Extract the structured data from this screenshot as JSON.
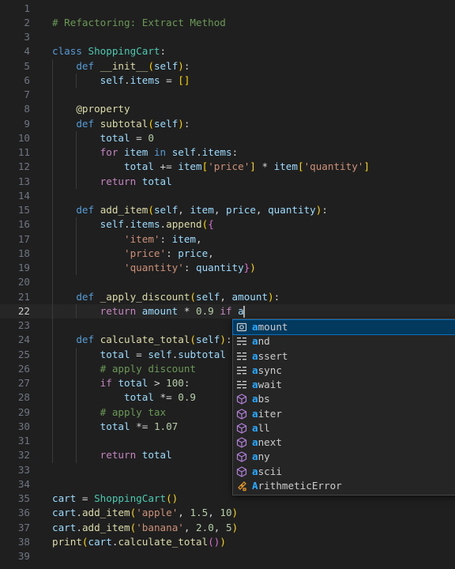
{
  "editor": {
    "active_line": 22,
    "lines": [
      {
        "n": "1",
        "t": []
      },
      {
        "n": "2",
        "t": [
          [
            "cm",
            "# Refactoring: Extract Method"
          ]
        ]
      },
      {
        "n": "3",
        "t": []
      },
      {
        "n": "4",
        "t": [
          [
            "k",
            "class"
          ],
          [
            "t",
            " "
          ],
          [
            "c",
            "ShoppingCart"
          ],
          [
            "t",
            ":"
          ]
        ]
      },
      {
        "n": "5",
        "t": [
          [
            "t",
            "    "
          ],
          [
            "k",
            "def"
          ],
          [
            "t",
            " "
          ],
          [
            "f",
            "__init__"
          ],
          [
            "b1",
            "("
          ],
          [
            "v",
            "self"
          ],
          [
            "b1",
            ")"
          ],
          [
            "t",
            ":"
          ]
        ]
      },
      {
        "n": "6",
        "t": [
          [
            "t",
            "        "
          ],
          [
            "v",
            "self"
          ],
          [
            "t",
            "."
          ],
          [
            "v",
            "items"
          ],
          [
            "t",
            " = "
          ],
          [
            "b1",
            "[]"
          ]
        ]
      },
      {
        "n": "7",
        "t": []
      },
      {
        "n": "8",
        "t": [
          [
            "t",
            "    "
          ],
          [
            "d",
            "@property"
          ]
        ]
      },
      {
        "n": "9",
        "t": [
          [
            "t",
            "    "
          ],
          [
            "k",
            "def"
          ],
          [
            "t",
            " "
          ],
          [
            "f",
            "subtotal"
          ],
          [
            "b1",
            "("
          ],
          [
            "v",
            "self"
          ],
          [
            "b1",
            ")"
          ],
          [
            "t",
            ":"
          ]
        ]
      },
      {
        "n": "10",
        "t": [
          [
            "t",
            "        "
          ],
          [
            "v",
            "total"
          ],
          [
            "t",
            " = "
          ],
          [
            "n",
            "0"
          ]
        ]
      },
      {
        "n": "11",
        "t": [
          [
            "t",
            "        "
          ],
          [
            "kc",
            "for"
          ],
          [
            "t",
            " "
          ],
          [
            "v",
            "item"
          ],
          [
            "t",
            " "
          ],
          [
            "k",
            "in"
          ],
          [
            "t",
            " "
          ],
          [
            "v",
            "self"
          ],
          [
            "t",
            "."
          ],
          [
            "v",
            "items"
          ],
          [
            "t",
            ":"
          ]
        ]
      },
      {
        "n": "12",
        "t": [
          [
            "t",
            "            "
          ],
          [
            "v",
            "total"
          ],
          [
            "t",
            " += "
          ],
          [
            "v",
            "item"
          ],
          [
            "b1",
            "["
          ],
          [
            "s",
            "'price'"
          ],
          [
            "b1",
            "]"
          ],
          [
            "t",
            " * "
          ],
          [
            "v",
            "item"
          ],
          [
            "b1",
            "["
          ],
          [
            "s",
            "'quantity'"
          ],
          [
            "b1",
            "]"
          ]
        ]
      },
      {
        "n": "13",
        "t": [
          [
            "t",
            "        "
          ],
          [
            "kc",
            "return"
          ],
          [
            "t",
            " "
          ],
          [
            "v",
            "total"
          ]
        ]
      },
      {
        "n": "14",
        "t": []
      },
      {
        "n": "15",
        "t": [
          [
            "t",
            "    "
          ],
          [
            "k",
            "def"
          ],
          [
            "t",
            " "
          ],
          [
            "f",
            "add_item"
          ],
          [
            "b1",
            "("
          ],
          [
            "v",
            "self"
          ],
          [
            "t",
            ", "
          ],
          [
            "v",
            "item"
          ],
          [
            "t",
            ", "
          ],
          [
            "v",
            "price"
          ],
          [
            "t",
            ", "
          ],
          [
            "v",
            "quantity"
          ],
          [
            "b1",
            ")"
          ],
          [
            "t",
            ":"
          ]
        ]
      },
      {
        "n": "16",
        "t": [
          [
            "t",
            "        "
          ],
          [
            "v",
            "self"
          ],
          [
            "t",
            "."
          ],
          [
            "v",
            "items"
          ],
          [
            "t",
            "."
          ],
          [
            "f",
            "append"
          ],
          [
            "b1",
            "("
          ],
          [
            "b2",
            "{"
          ]
        ]
      },
      {
        "n": "17",
        "t": [
          [
            "t",
            "            "
          ],
          [
            "s",
            "'item'"
          ],
          [
            "t",
            ": "
          ],
          [
            "v",
            "item"
          ],
          [
            "t",
            ","
          ]
        ]
      },
      {
        "n": "18",
        "t": [
          [
            "t",
            "            "
          ],
          [
            "s",
            "'price'"
          ],
          [
            "t",
            ": "
          ],
          [
            "v",
            "price"
          ],
          [
            "t",
            ","
          ]
        ]
      },
      {
        "n": "19",
        "t": [
          [
            "t",
            "            "
          ],
          [
            "s",
            "'quantity'"
          ],
          [
            "t",
            ": "
          ],
          [
            "v",
            "quantity"
          ],
          [
            "b2",
            "}"
          ],
          [
            "b1",
            ")"
          ]
        ]
      },
      {
        "n": "20",
        "t": []
      },
      {
        "n": "21",
        "t": [
          [
            "t",
            "    "
          ],
          [
            "k",
            "def"
          ],
          [
            "t",
            " "
          ],
          [
            "f",
            "_apply_discount"
          ],
          [
            "b1",
            "("
          ],
          [
            "v",
            "self"
          ],
          [
            "t",
            ", "
          ],
          [
            "v",
            "amount"
          ],
          [
            "b1",
            ")"
          ],
          [
            "t",
            ":"
          ]
        ]
      },
      {
        "n": "22",
        "t": [
          [
            "t",
            "        "
          ],
          [
            "kc",
            "return"
          ],
          [
            "t",
            " "
          ],
          [
            "v",
            "amount"
          ],
          [
            "t",
            " * "
          ],
          [
            "n",
            "0.9"
          ],
          [
            "t",
            " "
          ],
          [
            "kc",
            "if"
          ],
          [
            "t",
            " "
          ],
          [
            "v",
            "a"
          ]
        ],
        "cursor": true
      },
      {
        "n": "23",
        "t": []
      },
      {
        "n": "24",
        "t": [
          [
            "t",
            "    "
          ],
          [
            "k",
            "def"
          ],
          [
            "t",
            " "
          ],
          [
            "f",
            "calculate_total"
          ],
          [
            "b1",
            "("
          ],
          [
            "v",
            "self"
          ],
          [
            "b1",
            ")"
          ],
          [
            "t",
            ":"
          ]
        ]
      },
      {
        "n": "25",
        "t": [
          [
            "t",
            "        "
          ],
          [
            "v",
            "total"
          ],
          [
            "t",
            " = "
          ],
          [
            "v",
            "self"
          ],
          [
            "t",
            "."
          ],
          [
            "v",
            "subtotal"
          ]
        ]
      },
      {
        "n": "26",
        "t": [
          [
            "t",
            "        "
          ],
          [
            "cm",
            "# apply discount"
          ]
        ]
      },
      {
        "n": "27",
        "t": [
          [
            "t",
            "        "
          ],
          [
            "kc",
            "if"
          ],
          [
            "t",
            " "
          ],
          [
            "v",
            "total"
          ],
          [
            "t",
            " > "
          ],
          [
            "n",
            "100"
          ],
          [
            "t",
            ":"
          ]
        ]
      },
      {
        "n": "28",
        "t": [
          [
            "t",
            "            "
          ],
          [
            "v",
            "total"
          ],
          [
            "t",
            " *= "
          ],
          [
            "n",
            "0.9"
          ]
        ]
      },
      {
        "n": "29",
        "t": [
          [
            "t",
            "        "
          ],
          [
            "cm",
            "# apply tax"
          ]
        ]
      },
      {
        "n": "30",
        "t": [
          [
            "t",
            "        "
          ],
          [
            "v",
            "total"
          ],
          [
            "t",
            " *= "
          ],
          [
            "n",
            "1.07"
          ]
        ]
      },
      {
        "n": "31",
        "t": []
      },
      {
        "n": "32",
        "t": [
          [
            "t",
            "        "
          ],
          [
            "kc",
            "return"
          ],
          [
            "t",
            " "
          ],
          [
            "v",
            "total"
          ]
        ]
      },
      {
        "n": "33",
        "t": []
      },
      {
        "n": "34",
        "t": []
      },
      {
        "n": "35",
        "t": [
          [
            "v",
            "cart"
          ],
          [
            "t",
            " = "
          ],
          [
            "c",
            "ShoppingCart"
          ],
          [
            "b1",
            "()"
          ]
        ]
      },
      {
        "n": "36",
        "t": [
          [
            "v",
            "cart"
          ],
          [
            "t",
            "."
          ],
          [
            "f",
            "add_item"
          ],
          [
            "b1",
            "("
          ],
          [
            "s",
            "'apple'"
          ],
          [
            "t",
            ", "
          ],
          [
            "n",
            "1.5"
          ],
          [
            "t",
            ", "
          ],
          [
            "n",
            "10"
          ],
          [
            "b1",
            ")"
          ]
        ]
      },
      {
        "n": "37",
        "t": [
          [
            "v",
            "cart"
          ],
          [
            "t",
            "."
          ],
          [
            "f",
            "add_item"
          ],
          [
            "b1",
            "("
          ],
          [
            "s",
            "'banana'"
          ],
          [
            "t",
            ", "
          ],
          [
            "n",
            "2.0"
          ],
          [
            "t",
            ", "
          ],
          [
            "n",
            "5"
          ],
          [
            "b1",
            ")"
          ]
        ]
      },
      {
        "n": "38",
        "t": [
          [
            "f",
            "print"
          ],
          [
            "b1",
            "("
          ],
          [
            "v",
            "cart"
          ],
          [
            "t",
            "."
          ],
          [
            "f",
            "calculate_total"
          ],
          [
            "b2",
            "()"
          ],
          [
            "b1",
            ")"
          ]
        ]
      },
      {
        "n": "39",
        "t": []
      }
    ]
  },
  "suggest": {
    "prefix_char": "a",
    "items": [
      {
        "label": "amount",
        "icon": "variable-icon",
        "selected": true
      },
      {
        "label": "and",
        "icon": "keyword-icon"
      },
      {
        "label": "assert",
        "icon": "keyword-icon"
      },
      {
        "label": "async",
        "icon": "keyword-icon"
      },
      {
        "label": "await",
        "icon": "keyword-icon"
      },
      {
        "label": "abs",
        "icon": "function-cube-icon"
      },
      {
        "label": "aiter",
        "icon": "function-cube-icon"
      },
      {
        "label": "all",
        "icon": "function-cube-icon"
      },
      {
        "label": "anext",
        "icon": "function-cube-icon"
      },
      {
        "label": "any",
        "icon": "function-cube-icon"
      },
      {
        "label": "ascii",
        "icon": "function-cube-icon"
      },
      {
        "label": "ArithmeticError",
        "icon": "class-icon"
      }
    ]
  },
  "colors": {
    "background": "#1f1f1f",
    "keyword": "#569cd6",
    "control": "#c586c0",
    "function": "#dcdcaa",
    "class": "#4ec9b0",
    "variable": "#9cdcfe",
    "string": "#ce9178",
    "number": "#b5cea8",
    "comment": "#6a9955",
    "match_highlight": "#2aaaff",
    "icon_keyword": "#cccccc",
    "icon_function": "#b180d7",
    "icon_class": "#ee9d28",
    "icon_variable": "#75beff"
  }
}
